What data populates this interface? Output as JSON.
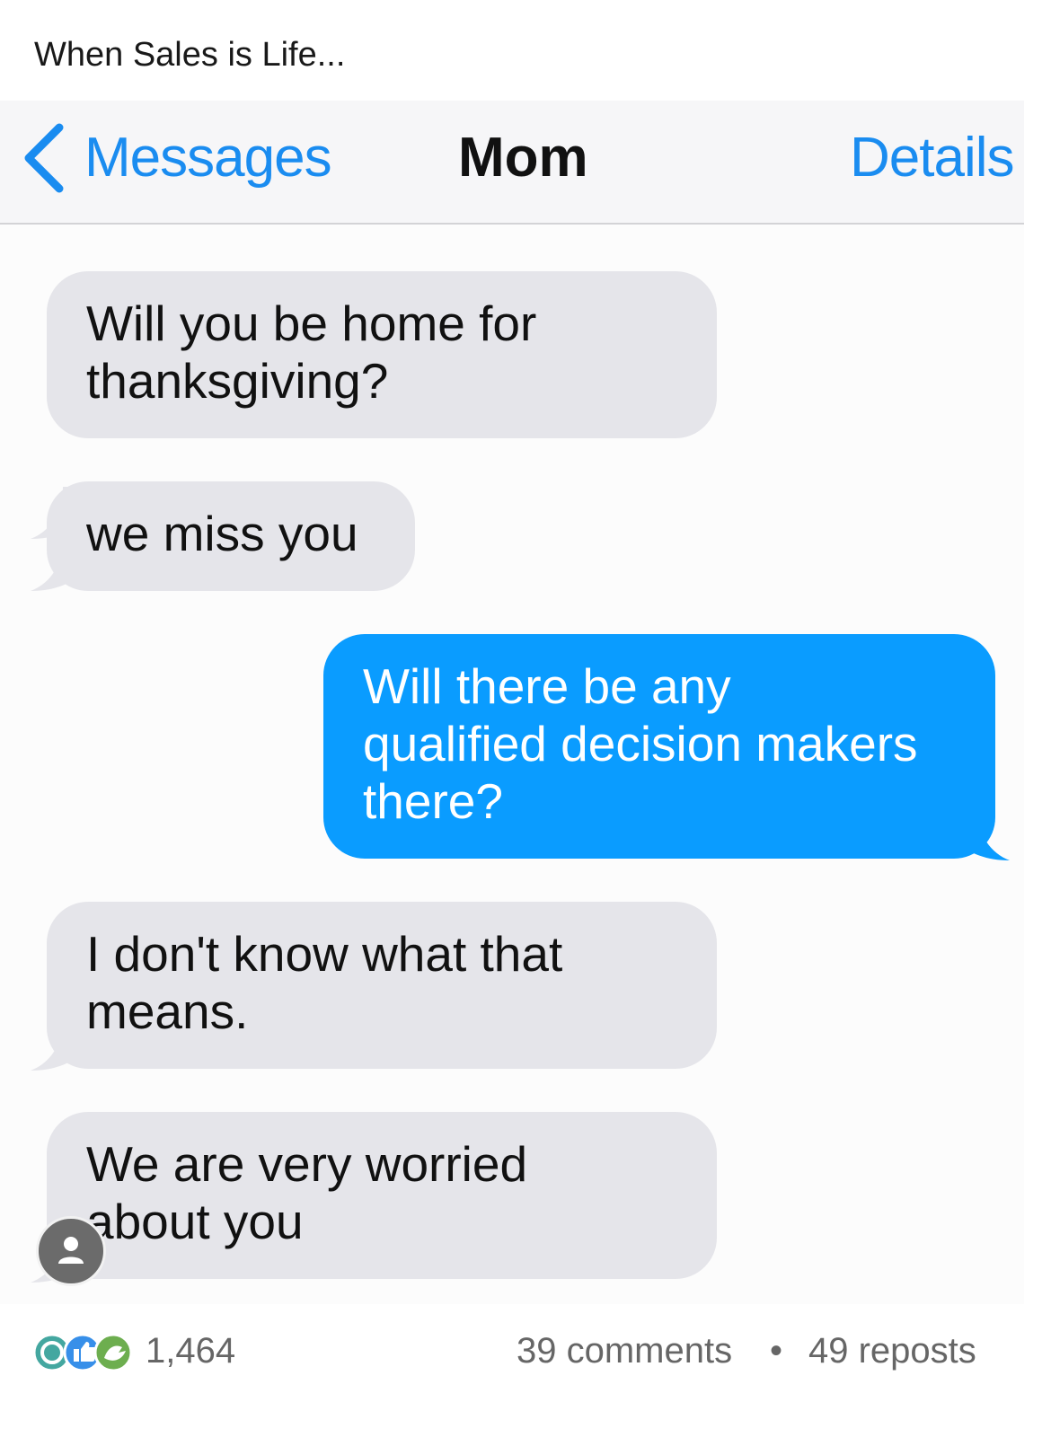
{
  "post": {
    "caption": "When Sales is Life..."
  },
  "imessage": {
    "back_label": "Messages",
    "contact_name": "Mom",
    "details_label": "Details",
    "colors": {
      "accent": "#1a8cf0",
      "incoming_bubble": "#e5e5ea",
      "outgoing_bubble": "#0a9cff"
    },
    "messages": [
      {
        "direction": "incoming",
        "lines": [
          "Will you be home for",
          "thanksgiving?"
        ]
      },
      {
        "direction": "incoming",
        "lines": [
          "we miss you"
        ]
      },
      {
        "direction": "outgoing",
        "lines": [
          "Will there be any",
          "qualified decision makers",
          "there?"
        ]
      },
      {
        "direction": "incoming",
        "lines": [
          "I don't know what that",
          "means."
        ]
      },
      {
        "direction": "incoming",
        "lines": [
          "We are very worried",
          "about you"
        ]
      }
    ]
  },
  "engagement": {
    "reaction_icons": [
      "celebrate-icon",
      "like-icon",
      "support-icon"
    ],
    "reaction_count": "1,464",
    "comments": "39 comments",
    "separator": "•",
    "reposts": "49 reposts"
  },
  "avatar": {
    "icon": "person-icon"
  }
}
